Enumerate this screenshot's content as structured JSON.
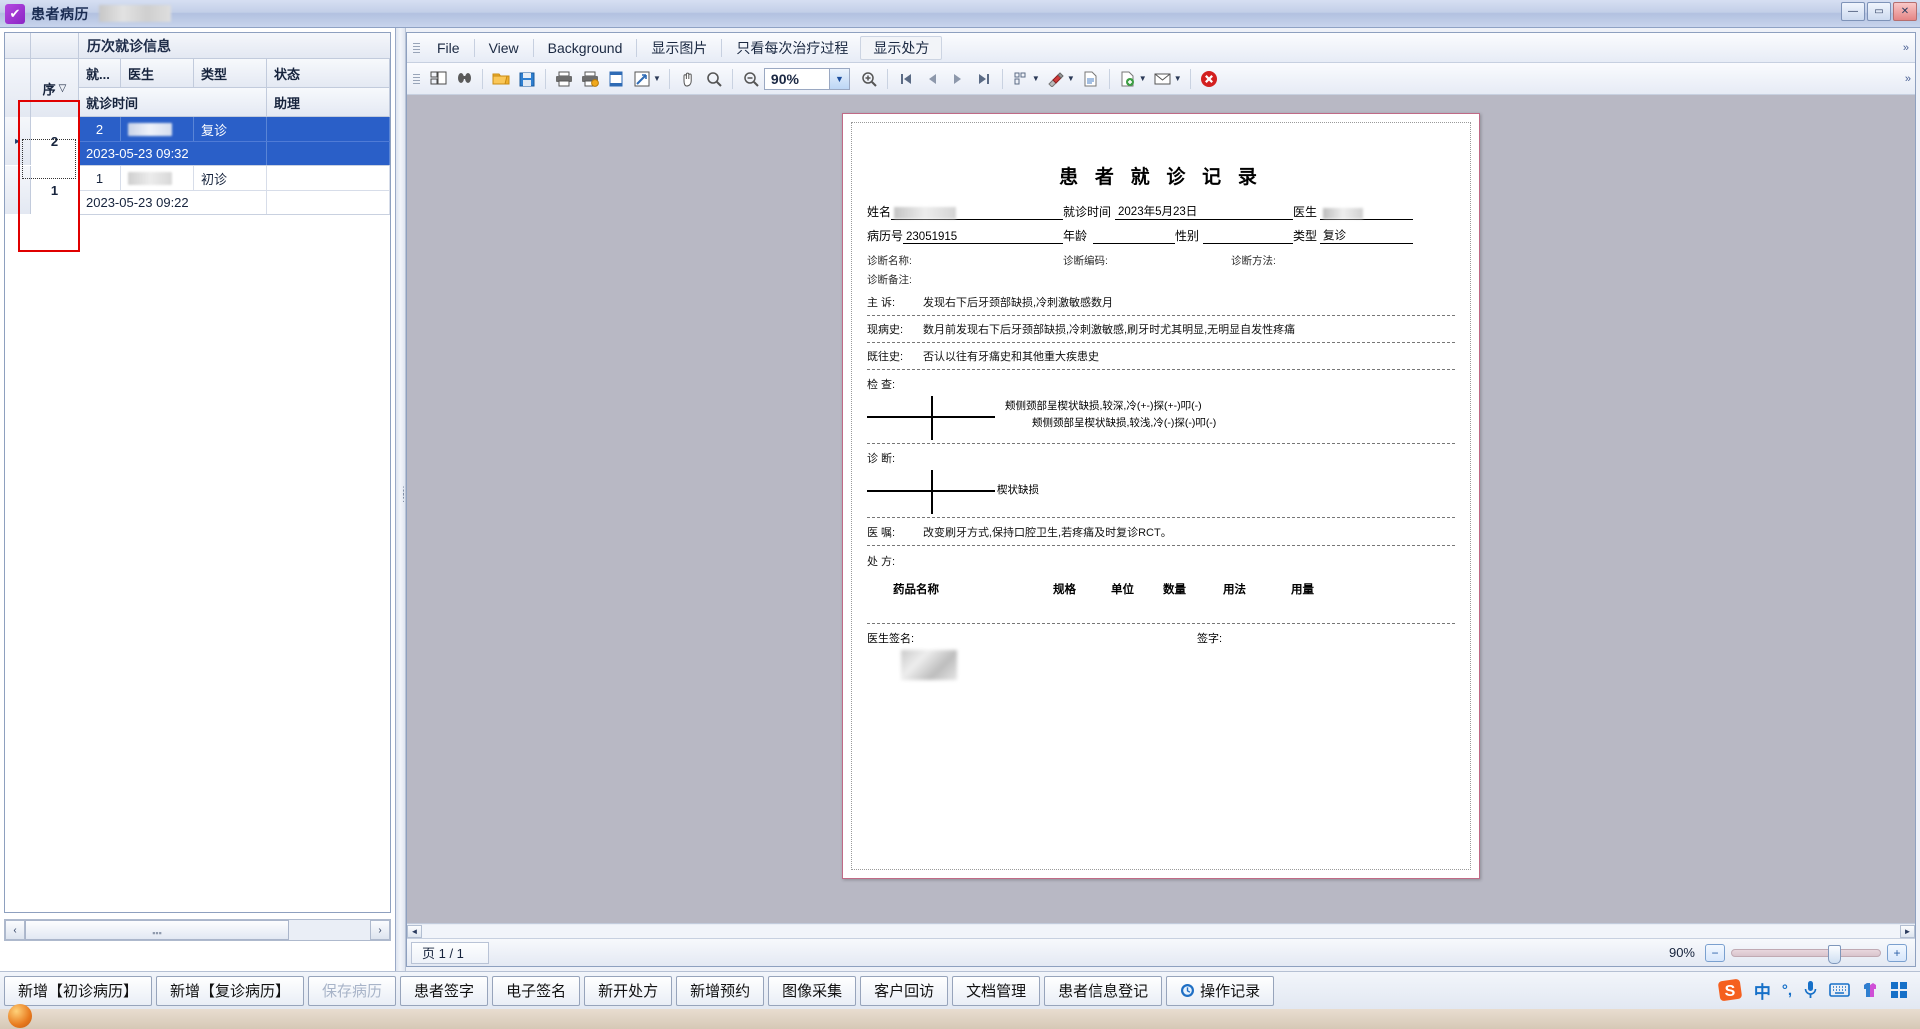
{
  "window": {
    "title": "患者病历",
    "redacted_title_suffix": true,
    "buttons": {
      "minimize": "—",
      "maximize": "▭",
      "close": "✕"
    }
  },
  "left_panel": {
    "band_title": "历次就诊信息",
    "columns_row1": [
      "就...",
      "医生",
      "类型",
      "状态"
    ],
    "columns_row2": [
      "就诊时间",
      "助理"
    ],
    "seq_header": "序",
    "seq_sort_glyph": "▽",
    "rows": [
      {
        "seq": "2",
        "visit_no": "2",
        "doctor": "",
        "doctor_redacted": true,
        "type": "复诊",
        "status": "",
        "visit_time": "2023-05-23 09:32",
        "assistant": "",
        "selected": true,
        "row_indicator": "▸"
      },
      {
        "seq": "1",
        "visit_no": "1",
        "doctor": "",
        "doctor_redacted": true,
        "type": "初诊",
        "status": "",
        "visit_time": "2023-05-23 09:22",
        "assistant": "",
        "selected": false,
        "row_indicator": ""
      }
    ],
    "scroll_left_glyph": "‹",
    "scroll_right_glyph": "›"
  },
  "viewer": {
    "menu": [
      {
        "label": "File",
        "active": false
      },
      {
        "label": "View",
        "active": false
      },
      {
        "label": "Background",
        "active": false
      },
      {
        "label": "显示图片",
        "active": false
      },
      {
        "label": "只看每次治疗过程",
        "active": false
      },
      {
        "label": "显示处方",
        "active": true
      }
    ],
    "menu_expander": "»",
    "toolbar": {
      "zoom_value": "90%",
      "icons": [
        "thumbnails-icon",
        "search-icon",
        "open-folder-icon",
        "save-icon",
        "print-icon",
        "quick-print-icon",
        "page-setup-icon",
        "scale-icon",
        "hand-tool-icon",
        "magnifier-icon",
        "zoom-out-icon",
        "zoom-in-icon",
        "first-page-icon",
        "previous-page-icon",
        "next-page-icon",
        "last-page-icon",
        "multipage-icon",
        "watermark-icon",
        "export-icon",
        "export-document-icon",
        "email-icon",
        "close-preview-icon"
      ],
      "expander": "»"
    },
    "document": {
      "title": "患 者 就 诊 记 录",
      "fields": [
        {
          "label": "姓名",
          "value": "",
          "redacted": true
        },
        {
          "label": "就诊时间",
          "value": "2023年5月23日",
          "redacted": false
        },
        {
          "label": "医生",
          "value": "",
          "redacted": true
        },
        {
          "label": "病历号",
          "value": "23051915",
          "redacted": false
        },
        {
          "label": "年龄",
          "value": "",
          "redacted": false
        },
        {
          "label": "性别",
          "value": "",
          "redacted": false
        },
        {
          "label": "类型",
          "value": "复诊",
          "redacted": false
        }
      ],
      "diag_row": [
        {
          "label": "诊断名称:",
          "value": ""
        },
        {
          "label": "诊断编码:",
          "value": ""
        },
        {
          "label": "诊断方法:",
          "value": ""
        }
      ],
      "diag_note_label": "诊断备注:",
      "sections": [
        {
          "key": "主  诉:",
          "text": "发现右下后牙颈部缺损,冷刺激敏感数月"
        },
        {
          "key": "现病史:",
          "text": "数月前发现右下后牙颈部缺损,冷刺激敏感,刷牙时尤其明显,无明显自发性疼痛"
        },
        {
          "key": "既往史:",
          "text": "否认以往有牙痛史和其他重大疾患史"
        }
      ],
      "exam_label": "检  查:",
      "exam_lines": [
        "颊侧颈部呈楔状缺损,较深,冷(+-)探(+-)叩(-)",
        "颊侧颈部呈楔状缺损,较浅,冷(-)探(-)叩(-)"
      ],
      "diagnosis_label": "诊  断:",
      "diagnosis_lines": [
        "楔状缺损"
      ],
      "advice_label": "医  嘱:",
      "advice_text": "改变刷牙方式,保持口腔卫生,若疼痛及时复诊RCT。",
      "rx_label": "处  方:",
      "rx_columns": [
        "药品名称",
        "规格",
        "单位",
        "数量",
        "用法",
        "用量"
      ],
      "rx_rows": [],
      "doctor_sign_label": "医生签名:",
      "doctor_sign_redacted": true,
      "signature_label": "签字:",
      "signature_value": ""
    },
    "status": {
      "page_text": "页 1 / 1",
      "zoom_pct": "90%",
      "zoom_out": "−",
      "zoom_in": "+"
    }
  },
  "bottom_bar": {
    "buttons": [
      {
        "label": "新增【初诊病历】",
        "disabled": false,
        "icon": ""
      },
      {
        "label": "新增【复诊病历】",
        "disabled": false,
        "icon": ""
      },
      {
        "label": "保存病历",
        "disabled": true,
        "icon": ""
      },
      {
        "label": "患者签字",
        "disabled": false,
        "icon": ""
      },
      {
        "label": "电子签名",
        "disabled": false,
        "icon": ""
      },
      {
        "label": "新开处方",
        "disabled": false,
        "icon": ""
      },
      {
        "label": "新增预约",
        "disabled": false,
        "icon": ""
      },
      {
        "label": "图像采集",
        "disabled": false,
        "icon": ""
      },
      {
        "label": "客户回访",
        "disabled": false,
        "icon": ""
      },
      {
        "label": "文档管理",
        "disabled": false,
        "icon": ""
      },
      {
        "label": "患者信息登记",
        "disabled": false,
        "icon": ""
      },
      {
        "label": "操作记录",
        "disabled": false,
        "icon": "history-icon"
      }
    ]
  },
  "tray": {
    "items": [
      {
        "name": "sogou-logo-icon",
        "glyph": "S"
      },
      {
        "name": "chinese-input-mode-icon",
        "glyph": "中"
      },
      {
        "name": "punctuation-mode-icon",
        "glyph": "°,"
      },
      {
        "name": "voice-input-icon",
        "glyph": "🎤"
      },
      {
        "name": "soft-keyboard-icon",
        "glyph": "⌨"
      },
      {
        "name": "skin-icon",
        "glyph": "👕"
      },
      {
        "name": "toolbox-icon",
        "glyph": "▦"
      }
    ]
  }
}
